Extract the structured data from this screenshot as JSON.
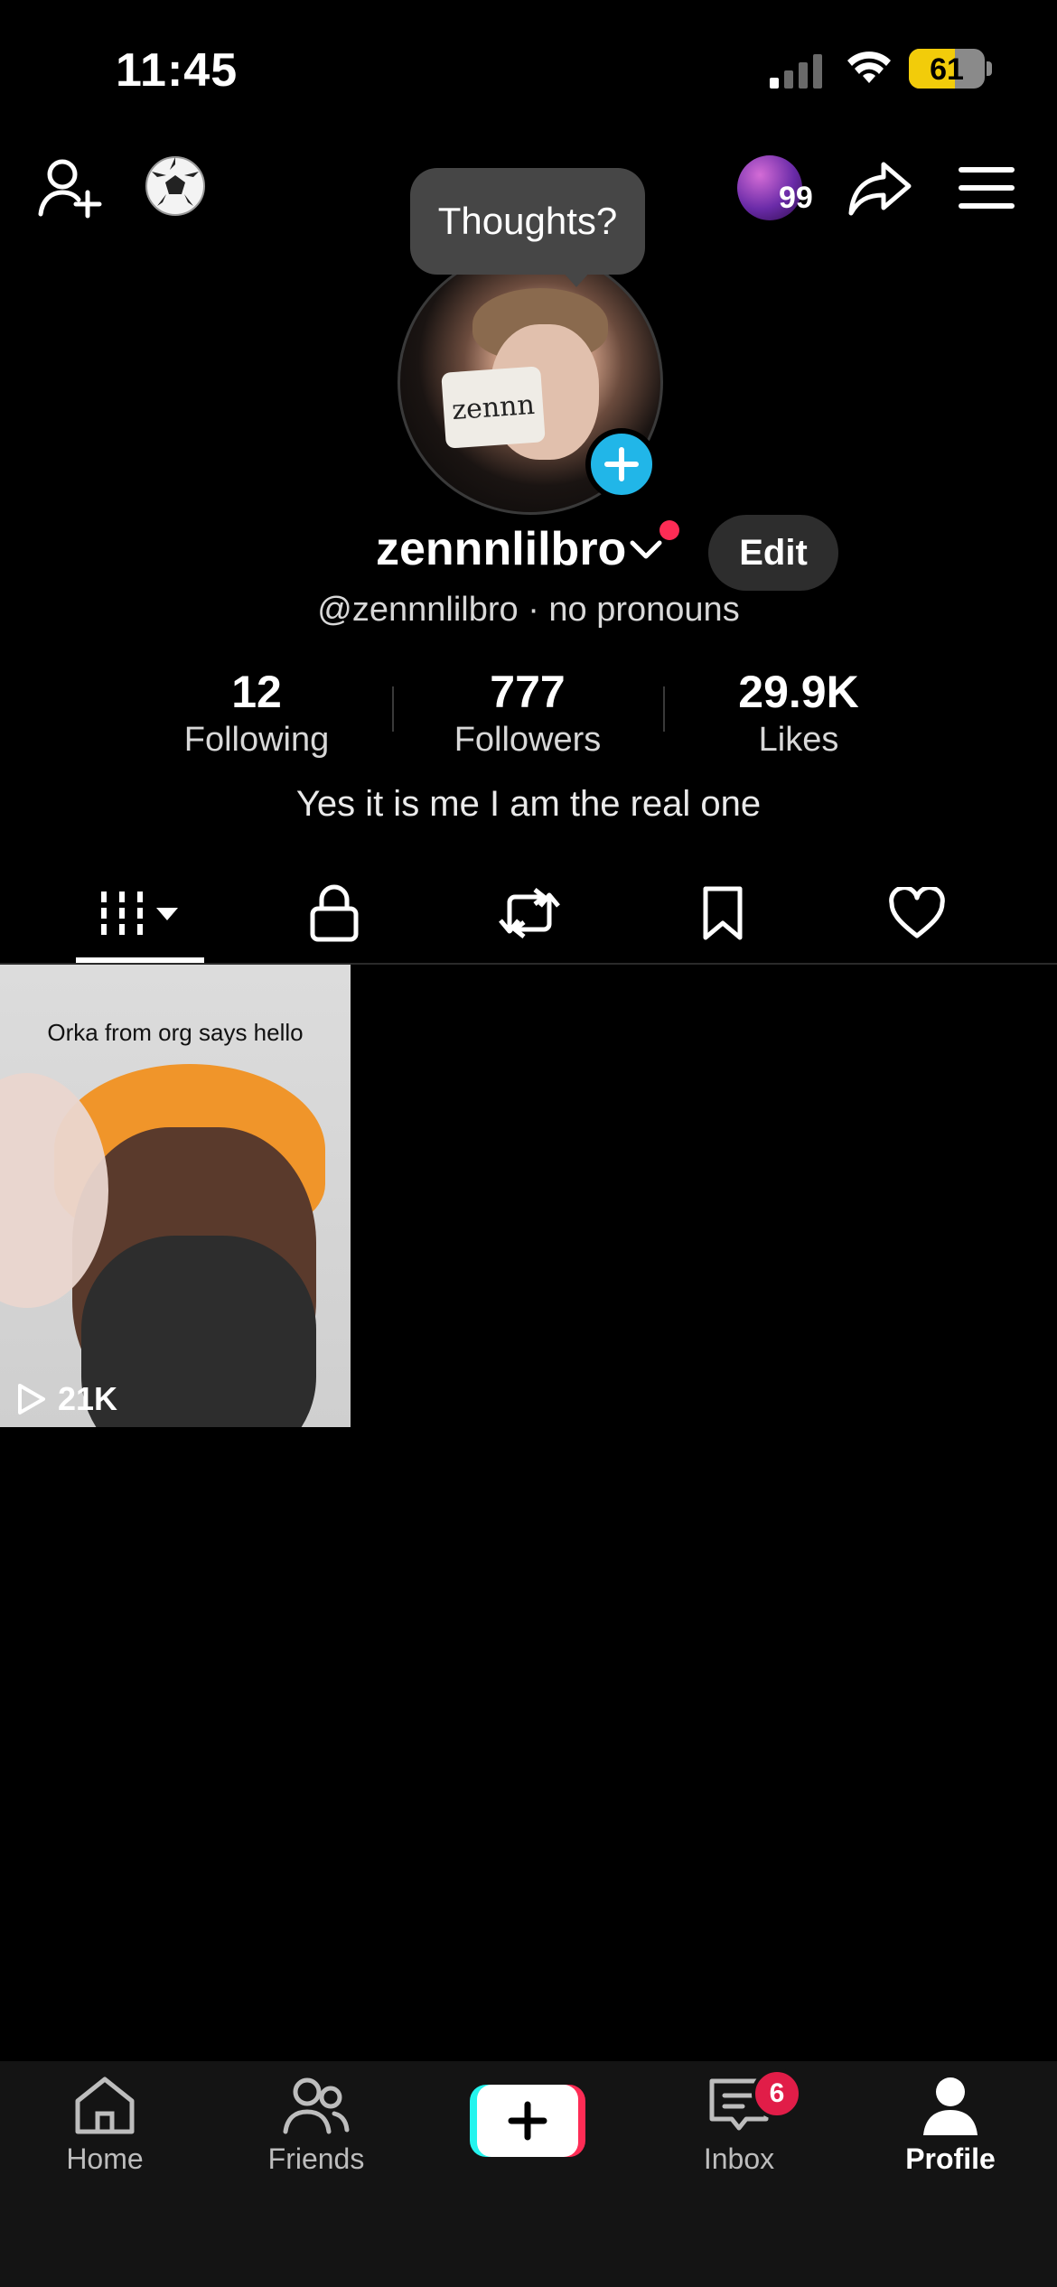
{
  "status_bar": {
    "time": "11:45",
    "battery": "61",
    "battery_level": 0.61
  },
  "header": {
    "add_friend_icon": "person-plus-icon",
    "soccer_icon": "soccer-ball-icon",
    "story_count": "99",
    "share_icon": "share-arrow-icon",
    "menu_icon": "hamburger-menu-icon"
  },
  "tooltip": {
    "text": "Thoughts?"
  },
  "avatar": {
    "paper_text": "zennn"
  },
  "profile": {
    "username": "zennnlilbro",
    "edit_label": "Edit",
    "handle_line": "@zennnlilbro · no pronouns",
    "bio": "Yes it is me I am the real one"
  },
  "stats": [
    {
      "value": "12",
      "label": "Following"
    },
    {
      "value": "777",
      "label": "Followers"
    },
    {
      "value": "29.9K",
      "label": "Likes"
    }
  ],
  "tabs": [
    "videos-grid-icon",
    "lock-icon",
    "repost-icon",
    "bookmark-icon",
    "heart-icon"
  ],
  "videos": [
    {
      "caption": "Orka from org says hello",
      "views": "21K"
    }
  ],
  "nav": {
    "items": [
      {
        "label": "Home",
        "icon": "home-icon"
      },
      {
        "label": "Friends",
        "icon": "friends-icon"
      },
      {
        "label": "",
        "icon": "plus-icon"
      },
      {
        "label": "Inbox",
        "icon": "inbox-icon"
      },
      {
        "label": "Profile",
        "icon": "profile-icon"
      }
    ],
    "inbox_badge": "6"
  },
  "colors": {
    "accent_blue": "#21b6e8",
    "brand_red": "#fe2c55",
    "brand_cyan": "#25f4ee",
    "battery_yellow": "#f2cc0a"
  }
}
